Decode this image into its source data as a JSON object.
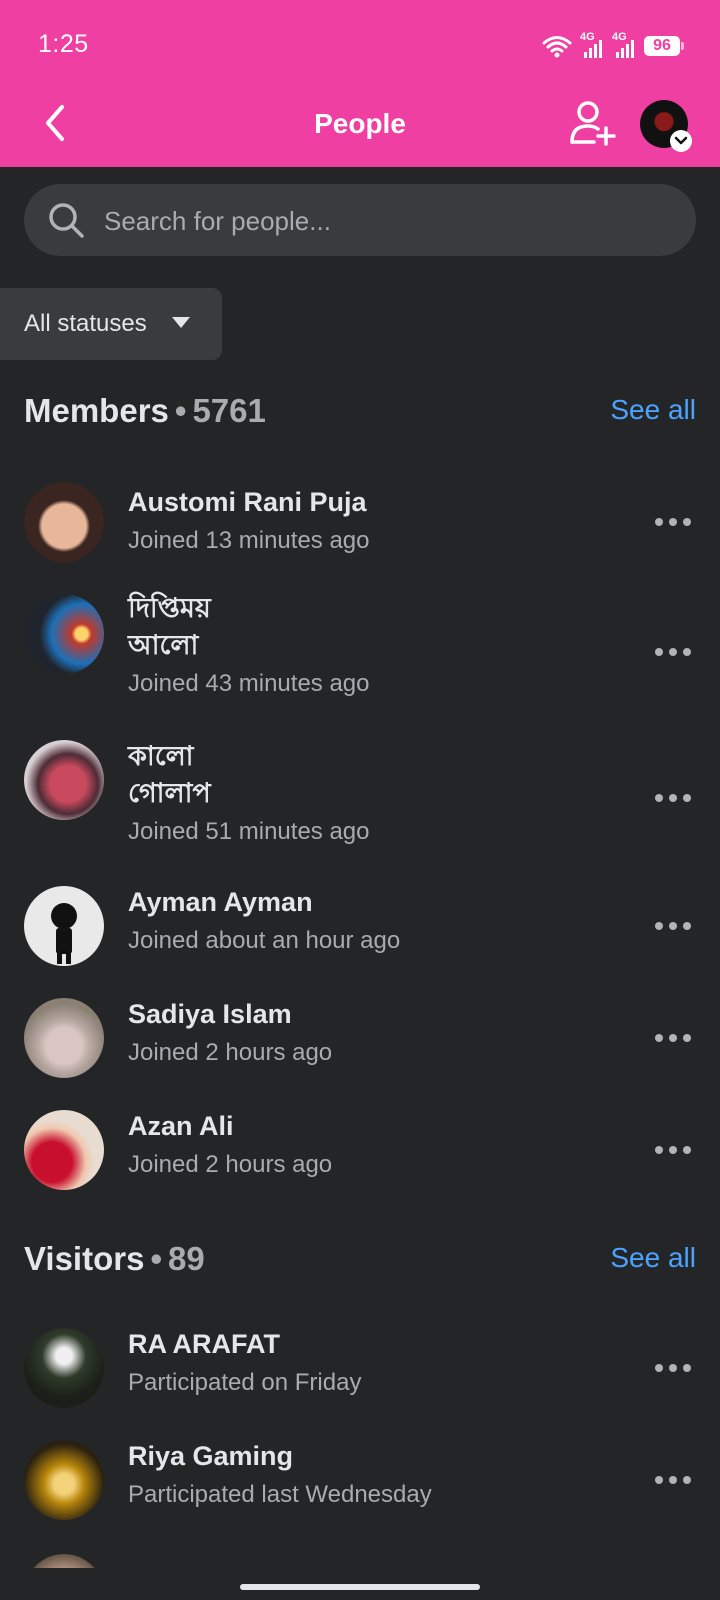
{
  "status_bar": {
    "time": "1:25",
    "network_1": "4G",
    "network_2": "4G",
    "battery": "96"
  },
  "header": {
    "title": "People",
    "back_icon": "chevron-left-icon",
    "add_icon": "add-person-icon",
    "bg_color": "#ef3fa3"
  },
  "search": {
    "placeholder": "Search for people..."
  },
  "filter": {
    "label": "All statuses"
  },
  "members": {
    "title": "Members",
    "count": "5761",
    "see_all": "See all",
    "items": [
      {
        "name": "Austomi Rani Puja",
        "sub": "Joined 13 minutes ago"
      },
      {
        "name": "দিপ্তিময় আলো",
        "sub": "Joined 43 minutes ago"
      },
      {
        "name": "কালো গোলাপ",
        "sub": "Joined 51 minutes ago"
      },
      {
        "name": "Ayman Ayman",
        "sub": "Joined about an hour ago"
      },
      {
        "name": "Sadiya Islam",
        "sub": "Joined 2 hours ago"
      },
      {
        "name": "Azan Ali",
        "sub": "Joined 2 hours ago"
      }
    ]
  },
  "visitors": {
    "title": "Visitors",
    "count": "89",
    "see_all": "See all",
    "items": [
      {
        "name": "RA ARAFAT",
        "sub": "Participated on Friday"
      },
      {
        "name": "Riya Gaming",
        "sub": "Participated last Wednesday"
      }
    ]
  },
  "colors": {
    "accent_link": "#4aa3ff",
    "background": "#242527"
  }
}
